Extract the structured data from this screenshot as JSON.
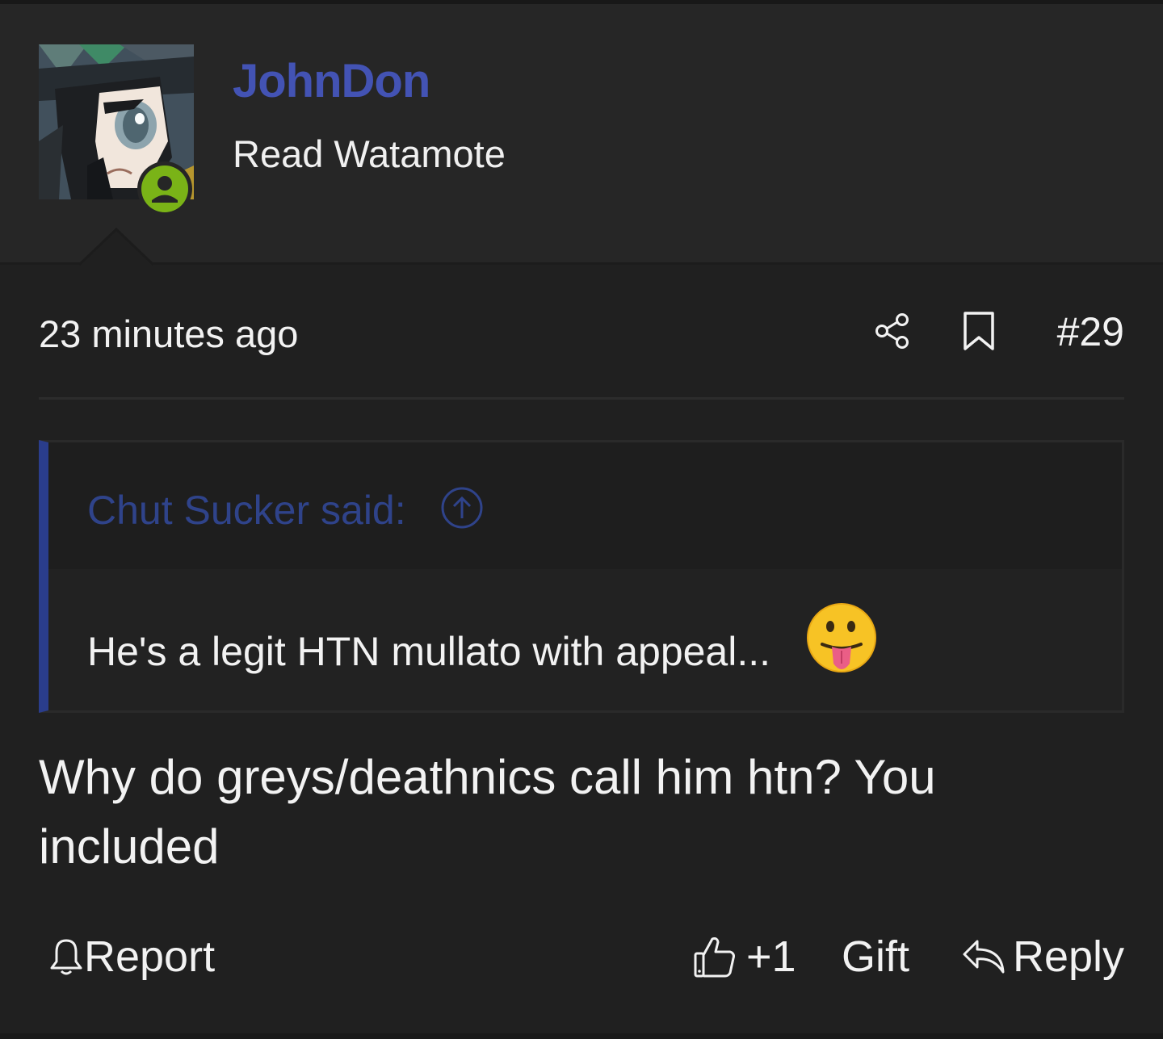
{
  "post": {
    "author": {
      "name": "JohnDon",
      "title": "Read Watamote",
      "status": "online"
    },
    "timestamp": "23 minutes ago",
    "post_number": "#29",
    "quote": {
      "author_text": "Chut Sucker said:",
      "text": "He's a legit HTN mullato with appeal...",
      "emoji": "face-with-tongue"
    },
    "body": "Why do greys/deathnics call him htn? You included"
  },
  "actions": {
    "report_label": "Report",
    "like_label": "+1",
    "gift_label": "Gift",
    "reply_label": "Reply"
  },
  "icons": {
    "share": "share-icon",
    "bookmark": "bookmark-icon",
    "quote_jump": "arrow-up-circle-icon",
    "report": "bell-icon",
    "like": "thumbs-up-icon",
    "reply": "reply-arrow-icon",
    "online": "user-icon"
  },
  "colors": {
    "background": "#202020",
    "user_block": "#262626",
    "username": "#4353b4",
    "quote_accent": "#2a3d8c",
    "quote_author": "#2f438a",
    "online_badge": "#7ab317",
    "text": "#f2f2f2"
  }
}
